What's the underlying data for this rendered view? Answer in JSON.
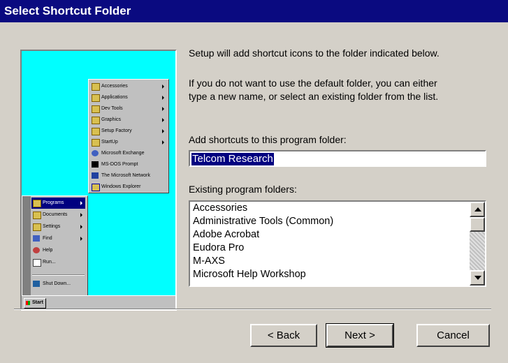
{
  "window": {
    "title": "Select Shortcut Folder"
  },
  "intro": {
    "line1": "Setup will add shortcut icons to the folder indicated below.",
    "line2a": "If you do not want to use the default folder, you can either",
    "line2b": "type a new name, or select an existing folder from the list."
  },
  "folder_field": {
    "label": "Add shortcuts to this program folder:",
    "value": "Telcom Research"
  },
  "existing": {
    "label": "Existing program folders:",
    "items": [
      "Accessories",
      "Administrative Tools (Common)",
      "Adobe Acrobat",
      "Eudora Pro",
      "M-AXS",
      "Microsoft Help Workshop"
    ]
  },
  "illustration": {
    "programs_menu": [
      "Accessories",
      "Applications",
      "Dev Tools",
      "Graphics",
      "Setup Factory",
      "StartUp",
      "Microsoft Exchange",
      "MS-DOS Prompt",
      "The Microsoft Network",
      "Windows Explorer"
    ],
    "start_menu": [
      "Programs",
      "Documents",
      "Settings",
      "Find",
      "Help",
      "Run...",
      "Shut Down..."
    ],
    "start_button": "Start"
  },
  "buttons": {
    "back": "< Back",
    "next": "Next >",
    "cancel": "Cancel"
  },
  "colors": {
    "title_bar": "#0a0a80",
    "desktop": "#00ffff",
    "selection": "#000080",
    "dialog_face": "#d4d0c8"
  }
}
